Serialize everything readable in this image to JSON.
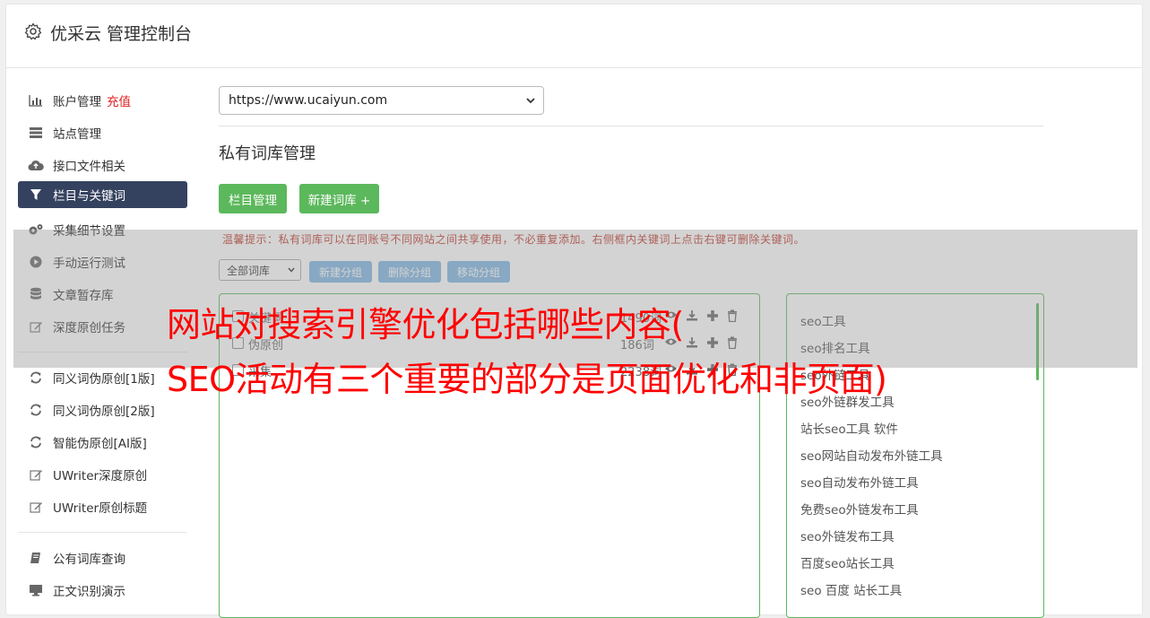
{
  "header": {
    "title": "优采云 管理控制台",
    "icon": "gear-icon"
  },
  "sidebar": {
    "items": [
      {
        "label": "账户管理",
        "badge": "充值",
        "icon": "bar-chart-icon"
      },
      {
        "label": "站点管理",
        "icon": "server-icon"
      },
      {
        "label": "接口文件相关",
        "icon": "cloud-upload-icon"
      },
      {
        "label": "栏目与关键词",
        "icon": "filter-icon",
        "active": true
      },
      {
        "label": "采集细节设置",
        "icon": "cogs-icon"
      },
      {
        "label": "手动运行测试",
        "icon": "play-circle-icon"
      },
      {
        "label": "文章暂存库",
        "icon": "database-icon"
      },
      {
        "label": "深度原创任务",
        "icon": "edit-icon"
      },
      {
        "label": "同义词伪原创[1版]",
        "icon": "refresh-icon"
      },
      {
        "label": "同义词伪原创[2版]",
        "icon": "refresh-icon"
      },
      {
        "label": "智能伪原创[AI版]",
        "icon": "refresh-icon"
      },
      {
        "label": "UWriter深度原创",
        "icon": "edit-icon"
      },
      {
        "label": "UWriter原创标题",
        "icon": "edit-icon"
      },
      {
        "label": "公有词库查询",
        "icon": "book-icon"
      },
      {
        "label": "正文识别演示",
        "icon": "monitor-icon"
      }
    ]
  },
  "main": {
    "site_select": "https://www.ucaiyun.com",
    "section_title": "私有词库管理",
    "btn_column": "栏目管理",
    "btn_new_lib": "新建词库 +",
    "tip": "温馨提示：私有词库可以在同账号不同网站之间共享使用，不必重复添加。右侧框内关键词上点击右键可删除关键词。",
    "filter_select": "全部词库",
    "btn_new_group": "新建分组",
    "btn_delete_group": "删除分组",
    "btn_move_group": "移动分组",
    "libraries": [
      {
        "name": "关键词",
        "count": "1490词"
      },
      {
        "name": "伪原创",
        "count": "186词"
      },
      {
        "name": "采集",
        "count": "2238词"
      }
    ],
    "keywords": [
      "seo工具",
      "seo排名工具",
      "seo外链工具",
      "seo外链群发工具",
      "站长seo工具 软件",
      "seo网站自动发布外链工具",
      "seo自动发布外链工具",
      "免费seo外链发布工具",
      "seo外链发布工具",
      "百度seo站长工具",
      "seo 百度 站长工具"
    ]
  },
  "overlay": {
    "line1": "网站对搜索引擎优化包括哪些内容(",
    "line2": "SEO活动有三个重要的部分是页面优化和非页面)"
  },
  "colors": {
    "sidebar_active": "#35425f",
    "green": "#5cb85c",
    "blue": "#7fb6e3",
    "headline": "#ff0000"
  }
}
